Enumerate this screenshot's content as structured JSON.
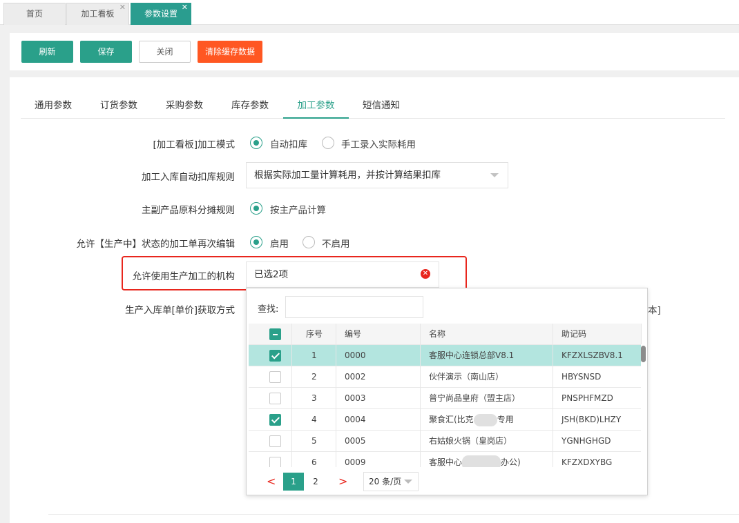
{
  "tabs": [
    {
      "label": "首页",
      "closable": false,
      "active": false
    },
    {
      "label": "加工看板",
      "closable": true,
      "active": false
    },
    {
      "label": "参数设置",
      "closable": true,
      "active": true
    }
  ],
  "toolbar": {
    "refresh": "刷新",
    "save": "保存",
    "close": "关闭",
    "clear_cache": "清除缓存数据"
  },
  "param_tabs": [
    "通用参数",
    "订货参数",
    "采购参数",
    "库存参数",
    "加工参数",
    "短信通知"
  ],
  "param_tabs_active": "加工参数",
  "form": {
    "mode_label": "[加工看板]加工模式",
    "mode_options": [
      "自动扣库",
      "手工录入实际耗用"
    ],
    "mode_selected": "自动扣库",
    "deduct_rule_label": "加工入库自动扣库规则",
    "deduct_rule_value": "根据实际加工量计算耗用，并按计算结果扣库",
    "share_rule_label": "主副产品原料分摊规则",
    "share_rule_options": [
      "按主产品计算"
    ],
    "share_rule_selected": "按主产品计算",
    "reedit_label": "允许【生产中】状态的加工单再次编辑",
    "reedit_options": [
      "启用",
      "不启用"
    ],
    "reedit_selected": "启用",
    "org_label": "允许使用生产加工的机构",
    "org_value": "已选2项",
    "price_label": "生产入库单[单价]获取方式",
    "price_tail": "本]"
  },
  "dropdown": {
    "search_label": "查找:",
    "search_value": "",
    "columns": [
      "序号",
      "编号",
      "名称",
      "助记码"
    ],
    "rows": [
      {
        "no": "1",
        "code": "0000",
        "name": "客服中心连锁总部V8.1",
        "mnemonic": "KFZXLSZBV8.1",
        "checked": true
      },
      {
        "no": "2",
        "code": "0002",
        "name": "伙伴演示（南山店）",
        "mnemonic": "HBYSNSD",
        "checked": false
      },
      {
        "no": "3",
        "code": "0003",
        "name": "普宁尚品皇府（盟主店）",
        "mnemonic": "PNSPHFMZD",
        "checked": false
      },
      {
        "no": "4",
        "code": "0004",
        "name": "聚食汇(比克",
        "name_tail": "专用",
        "mnemonic": "JSH(BKD)LHZY",
        "checked": true
      },
      {
        "no": "5",
        "code": "0005",
        "name": "右姑娘火锅（皇岗店）",
        "mnemonic": "YGNHGHGD",
        "checked": false
      },
      {
        "no": "6",
        "code": "0009",
        "name": "客服中心",
        "name_tail": "办公)",
        "mnemonic": "KFZXDXYBG",
        "checked": false
      }
    ],
    "pager": {
      "prev": "<",
      "next": ">",
      "pages": [
        "1",
        "2"
      ],
      "current": "1",
      "per_page": "20 条/页"
    }
  },
  "colors": {
    "primary": "#2aa08a",
    "danger": "#ff5722",
    "highlight": "#e8261d",
    "selected_row": "#b3e5df"
  }
}
